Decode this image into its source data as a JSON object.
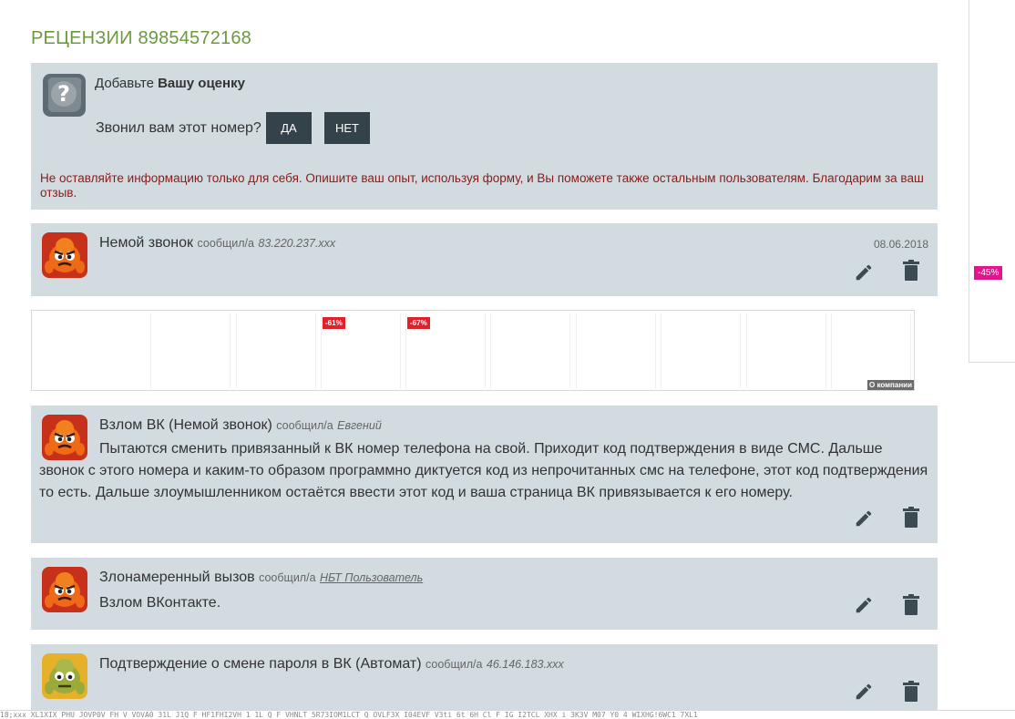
{
  "section_title": "РЕЦЕНЗИИ 89854572168",
  "rating": {
    "head_prefix": "Добавьте",
    "head_bold": "Вашу оценку",
    "question": "Звонил вам этот номер?",
    "yes_label": "ДА",
    "no_label": "НЕТ",
    "note": "Не оставляйте информацию только для себя. Опишите ваш опыт, используя форму, и Вы поможете также остальным пользователям. Благодарим за ваш отзыв."
  },
  "reviews": [
    {
      "title": "Немой звонок",
      "reported": "сообщил/а",
      "author": "83.220.237.xxx",
      "date": "08.06.2018",
      "text": ""
    },
    {
      "title": "Взлом ВК (Немой звонок)",
      "reported": "сообщил/а",
      "author": "Евгений",
      "date": "",
      "text": "Пытаются сменить привязанный к ВК номер телефона на свой. Приходит код подтверждения в виде СМС. Дальше звонок с этого номера и каким-то образом программно диктуется код из непрочитанных смс на телефоне, этот код подтверждения то есть. Дальше злоумышленником остаётся ввести этот код и ваша страница ВК привязывается к его номеру."
    },
    {
      "title": "Злонамеренный вызов",
      "reported": "сообщил/а",
      "author": "НБТ Пользователь",
      "date": "",
      "text": "Взлом ВКонтакте."
    },
    {
      "title": "Подтверждение о смене пароля в ВК (Автомат)",
      "reported": "сообщил/а",
      "author": "46.146.183.xxx",
      "date": "",
      "text": ""
    }
  ],
  "ads": {
    "badges": [
      "-61%",
      "-67%"
    ],
    "company_label": "О компании",
    "side_badge": "-45%"
  },
  "bottom_strip_text": "18;xxx XL1XIX PHU JOVP0V FH V VOVA0 31L J1Q F HF1FHI2VH 1 1L Q F VHNLT 5R73IOM1LCT Q OVLF3X I04EVF V3ti 6t 6H Cl F IG I2TCL XHX i 3K3V M07 Y0 4 WIXHG!6WC1 7XL1"
}
